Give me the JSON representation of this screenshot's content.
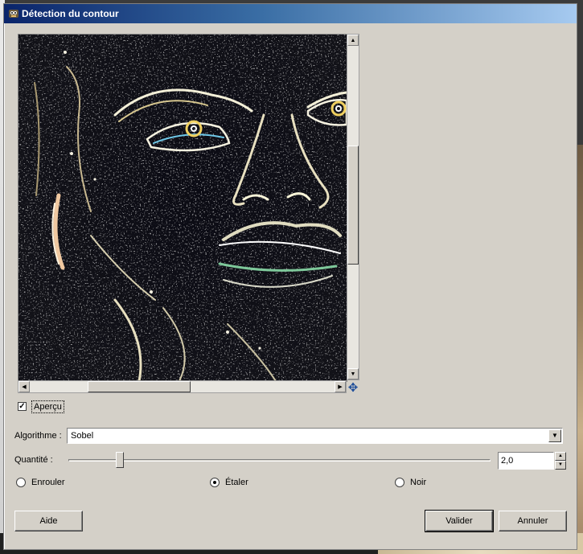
{
  "window": {
    "title": "Détection du contour",
    "app_icon": "gimp-icon"
  },
  "preview": {
    "checkbox_label": "Aperçu",
    "checked": true,
    "navigate_icon": "navigate-icon"
  },
  "algorithm": {
    "label": "Algorithme :",
    "value": "Sobel"
  },
  "amount": {
    "label": "Quantité :",
    "value": "2,0",
    "slider_fraction": 0.12
  },
  "edge_mode": {
    "options": [
      {
        "label": "Enrouler",
        "selected": false
      },
      {
        "label": "Étaler",
        "selected": true
      },
      {
        "label": "Noir",
        "selected": false
      }
    ]
  },
  "buttons": {
    "help": "Aide",
    "ok": "Valider",
    "cancel": "Annuler"
  }
}
